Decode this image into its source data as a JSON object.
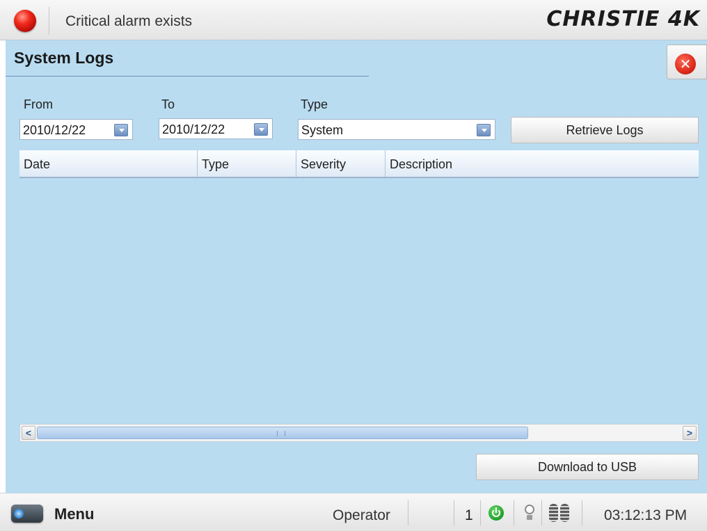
{
  "header": {
    "alarm_text": "Critical alarm exists",
    "brand": "CHRISTIE 4K",
    "alarm_icon": "red-alarm-light",
    "alarm_color": "#e0241a"
  },
  "page": {
    "title": "System Logs",
    "close_icon": "close-x-icon"
  },
  "filters": {
    "from": {
      "label": "From",
      "value": "2010/12/22"
    },
    "to": {
      "label": "To",
      "value": "2010/12/22"
    },
    "type": {
      "label": "Type",
      "value": "System"
    },
    "retrieve_label": "Retrieve Logs"
  },
  "table": {
    "columns": [
      "Date",
      "Type",
      "Severity",
      "Description"
    ],
    "rows": []
  },
  "scrollbar": {
    "left_arrow": "<",
    "right_arrow": ">"
  },
  "download_label": "Download to USB",
  "footer": {
    "menu_label": "Menu",
    "menu_icon": "projector-icon",
    "user": "Operator",
    "count": "1",
    "status_icons": [
      "power-icon",
      "lamp-bulb-icon",
      "film-reel-icon"
    ],
    "time": "03:12:13 PM"
  },
  "colors": {
    "panel_background": "#b9dcf1",
    "accent_blue": "#6d8fc0"
  }
}
